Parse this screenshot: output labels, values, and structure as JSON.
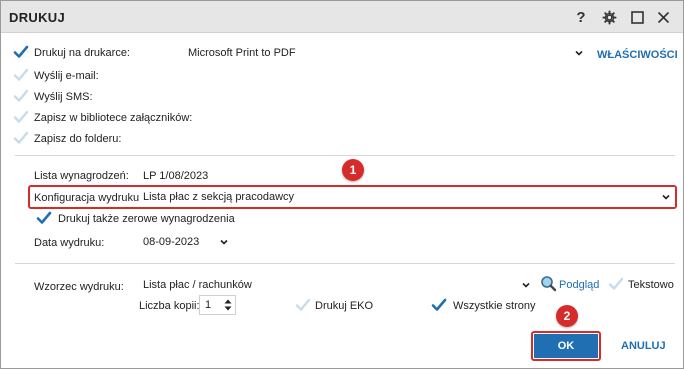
{
  "window": {
    "title": "DRUKUJ"
  },
  "titlebar": {
    "help_glyph": "?"
  },
  "outputs": {
    "printer_label": "Drukuj na drukarce:",
    "printer_checked": true,
    "printer_value": "Microsoft Print to PDF",
    "properties_link": "WŁAŚCIWOŚCI",
    "email_label": "Wyślij e-mail:",
    "sms_label": "Wyślij SMS:",
    "attachments_label": "Zapisz w bibliotece załączników:",
    "folder_label": "Zapisz do folderu:"
  },
  "form": {
    "payroll_list_label": "Lista wynagrodzeń:",
    "payroll_list_value": "LP 1/08/2023",
    "config_label": "Konfiguracja wydruku:",
    "config_value": "Lista płac z sekcją pracodawcy",
    "zero_pay_label": "Drukuj także zerowe wynagrodzenia",
    "zero_pay_checked": true,
    "print_date_label": "Data wydruku:",
    "print_date_value": "08-09-2023"
  },
  "template": {
    "label": "Wzorzec wydruku:",
    "value": "Lista płac / rachunków",
    "preview_link": "Podgląd",
    "text_label": "Tekstowo",
    "copies_label": "Liczba kopii:",
    "copies_value": "1",
    "eko_label": "Drukuj EKO",
    "all_pages_label": "Wszystkie strony",
    "all_pages_checked": true
  },
  "buttons": {
    "ok": "OK",
    "cancel": "ANULUJ"
  },
  "annotations": {
    "badge1": "1",
    "badge2": "2"
  },
  "colors": {
    "accent": "#1f6fb2",
    "highlight": "#d62b2b",
    "check_active": "#1f6fb2",
    "check_inactive": "#c5dced"
  }
}
